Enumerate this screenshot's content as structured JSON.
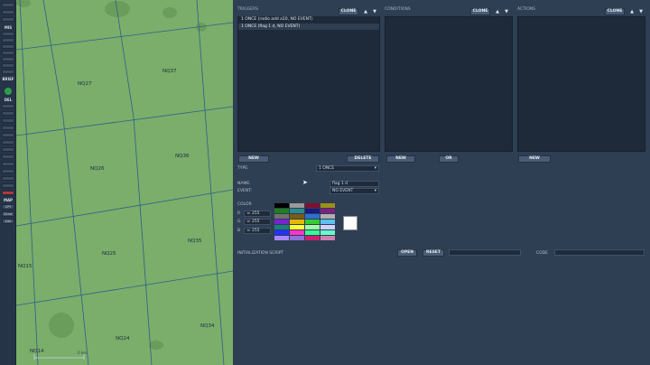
{
  "toolbar": {
    "mis": "MIS",
    "briefing": "BRIEF",
    "del": "DEL",
    "map": "MAP",
    "copy": "CPY",
    "draw": "Draw",
    "edit": "Edit"
  },
  "map": {
    "grid_labels": [
      "NQ27",
      "NQ37",
      "NQ26",
      "NQ36",
      "NQ25",
      "NQ35",
      "NQ15",
      "NQ24",
      "NQ34",
      "NQ14"
    ],
    "scale": "0 km"
  },
  "triggers": {
    "heading": "TRIGGERS",
    "clone": "CLONE",
    "rows": [
      "1 ONCE (radio add a10, NO EVENT)",
      "1 ONCE (flag 1 d, NO EVENT)"
    ],
    "new": "NEW",
    "delete": "DELETE"
  },
  "conditions": {
    "heading": "CONDITIONS",
    "clone": "CLONE",
    "new": "NEW",
    "or": "OR"
  },
  "actions": {
    "heading": "ACTIONS",
    "clone": "CLONE",
    "new": "NEW"
  },
  "form": {
    "type_label": "TYPE:",
    "type_value": "1 ONCE",
    "name_label": "NAME:",
    "name_value": "flag 1 d",
    "event_label": "EVENT:",
    "event_value": "NO EVENT",
    "color_label": "COLOR",
    "r_label": "R",
    "g_label": "G",
    "b_label": "B",
    "r_value": "255",
    "g_value": "255",
    "b_value": "255",
    "init_script_label": "INITIALIZATION SCRIPT",
    "open": "OPEN",
    "reset": "RESET",
    "code_label": "CODE"
  },
  "palette": [
    "#000000",
    "#9a9a9a",
    "#7f1030",
    "#9c8f1a",
    "#1f7f1f",
    "#2a8c8c",
    "#1a1a7f",
    "#7f1f7f",
    "#6f6f6f",
    "#7a5a1a",
    "#2d6fd0",
    "#b0b0b0",
    "#7a22d0",
    "#e6b800",
    "#33cc33",
    "#5fc0f0",
    "#1a7f7f",
    "#ffff33",
    "#a0ffa0",
    "#d0d0ff",
    "#2233ff",
    "#ff33cc",
    "#33ff99",
    "#66ffcc",
    "#aa88ff",
    "#8f6fd8",
    "#cc1f6f",
    "#d080b0"
  ]
}
